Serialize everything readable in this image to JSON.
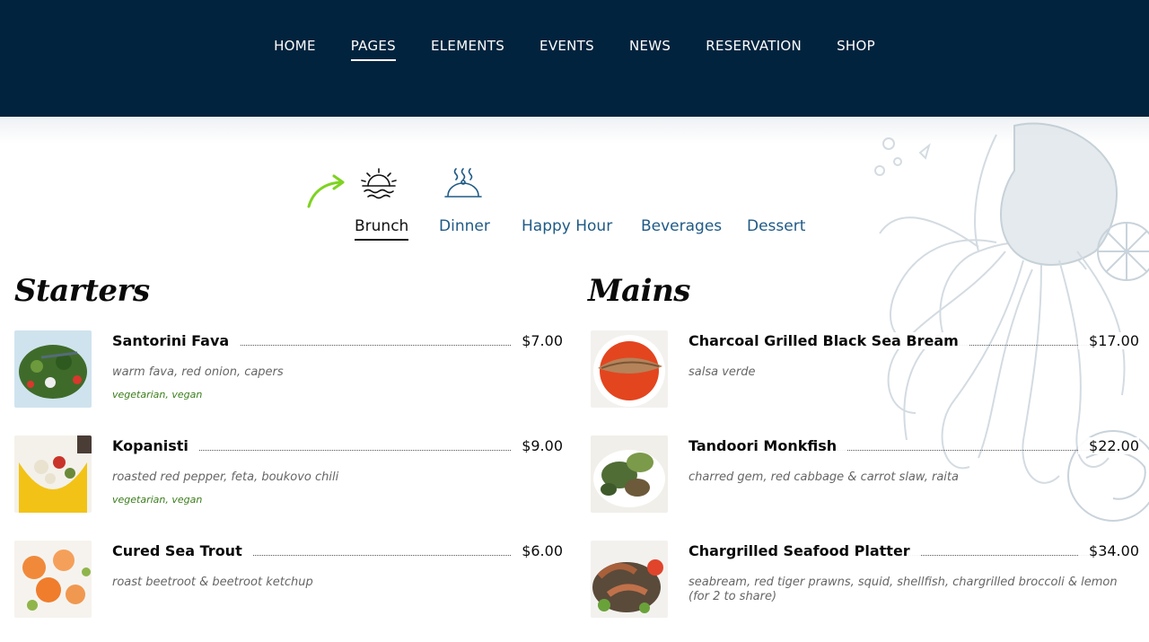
{
  "nav": {
    "items": [
      "HOME",
      "PAGES",
      "ELEMENTS",
      "EVENTS",
      "NEWS",
      "RESERVATION",
      "SHOP"
    ],
    "active_index": 1
  },
  "icons": {
    "brunch": "sunrise-icon",
    "dinner": "cloche-icon",
    "hint": "curved-arrow-icon"
  },
  "colors": {
    "header_bg": "#02233d",
    "tab_link": "#1f5a86",
    "tag_green": "#3a7d1a",
    "arrow_green": "#7ed321"
  },
  "tabs": [
    "Brunch",
    "Dinner",
    "Happy Hour",
    "Beverages",
    "Dessert"
  ],
  "active_tab": "Brunch",
  "starters": {
    "title": "Starters",
    "items": [
      {
        "name": "Santorini Fava",
        "price": "$7.00",
        "desc": "warm fava, red onion, capers",
        "tags": "vegetarian, vegan"
      },
      {
        "name": "Kopanisti",
        "price": "$9.00",
        "desc": "roasted red pepper, feta, boukovo chili",
        "tags": "vegetarian, vegan"
      },
      {
        "name": "Cured Sea Trout",
        "price": "$6.00",
        "desc": "roast beetroot & beetroot ketchup",
        "tags": ""
      }
    ]
  },
  "mains": {
    "title": "Mains",
    "items": [
      {
        "name": "Charcoal Grilled Black Sea Bream",
        "price": "$17.00",
        "desc": "salsa verde"
      },
      {
        "name": "Tandoori Monkfish",
        "price": "$22.00",
        "desc": "charred gem, red cabbage & carrot slaw, raita"
      },
      {
        "name": "Chargrilled Seafood Platter",
        "price": "$34.00",
        "desc": "seabream, red tiger prawns, squid, shellfish, chargrilled broccoli & lemon (for 2 to share)"
      }
    ]
  }
}
